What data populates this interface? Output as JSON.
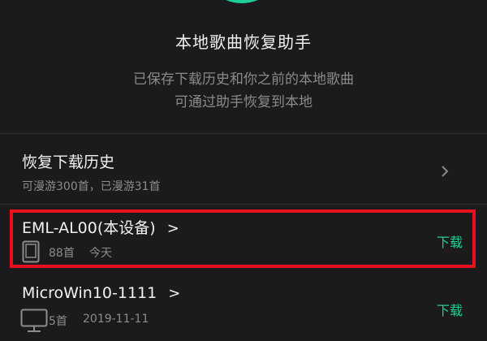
{
  "header": {
    "title": "本地歌曲恢复助手",
    "desc_line1": "已保存下载历史和你之前的本地歌曲",
    "desc_line2": "可通过助手恢复到本地"
  },
  "restore": {
    "title": "恢复下载历史",
    "subtitle": "可漫游300首，已漫游31首"
  },
  "devices": [
    {
      "name": "EML-AL00(本设备)",
      "count": "88首",
      "date": "今天",
      "action": "下载",
      "icon": "tablet-icon"
    },
    {
      "name": "MicroWin10-1111",
      "count": "5首",
      "date": "2019-11-11",
      "action": "下载",
      "icon": "monitor-icon"
    }
  ],
  "colors": {
    "accent": "#1fcf98",
    "highlight": "#e8101a",
    "background": "#1b1b1d"
  }
}
